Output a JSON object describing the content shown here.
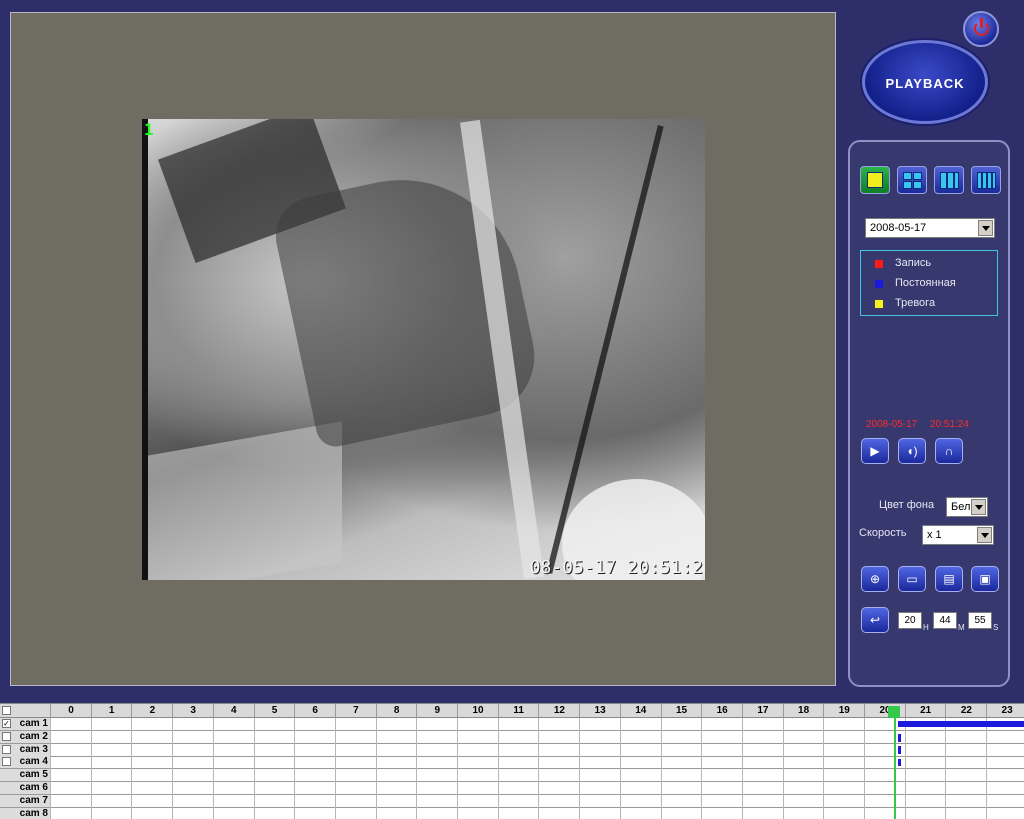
{
  "window": {
    "logo_text": "PLAYBACK"
  },
  "video": {
    "channel_label": "1",
    "osd_timestamp": "08-05-17 20:51:2"
  },
  "controls": {
    "date_select": "2008-05-17",
    "legend": [
      {
        "label": "Запись",
        "color": "#ff1a1a"
      },
      {
        "label": "Постоянная",
        "color": "#1a1adc"
      },
      {
        "label": "Тревога",
        "color": "#f5f21c"
      }
    ],
    "current_date": "2008-05-17",
    "current_time": "20:51:24",
    "background_color_label": "Цвет фона",
    "background_color_value": "Бель",
    "speed_label": "Скорость",
    "speed_value": "x 1",
    "time_hours": "20",
    "time_minutes": "44",
    "time_seconds": "55",
    "unit_h": "H",
    "unit_m": "M",
    "unit_s": "S"
  },
  "timeline": {
    "hours": [
      "0",
      "1",
      "2",
      "3",
      "4",
      "5",
      "6",
      "7",
      "8",
      "9",
      "10",
      "11",
      "12",
      "13",
      "14",
      "15",
      "16",
      "17",
      "18",
      "19",
      "20",
      "21",
      "22",
      "23"
    ],
    "cameras": [
      {
        "label": "cam 1",
        "checked": true,
        "check_mark": "✓"
      },
      {
        "label": "cam 2",
        "checked": false,
        "check_mark": ""
      },
      {
        "label": "cam 3",
        "checked": false,
        "check_mark": ""
      },
      {
        "label": "cam 4",
        "checked": false,
        "check_mark": ""
      },
      {
        "label": "cam 5",
        "checked": false,
        "check_mark": ""
      },
      {
        "label": "cam 6",
        "checked": false,
        "check_mark": ""
      },
      {
        "label": "cam 7",
        "checked": false,
        "check_mark": ""
      },
      {
        "label": "cam 8",
        "checked": false,
        "check_mark": ""
      }
    ],
    "cursor_hour": 20.73
  }
}
